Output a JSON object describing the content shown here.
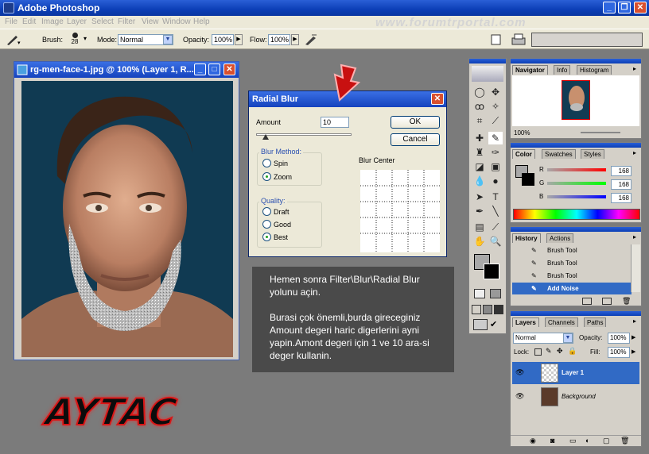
{
  "window": {
    "title": "Adobe Photoshop",
    "minimize": "_",
    "restore": "❐",
    "close": "✕"
  },
  "watermark": "www.forumtrportal.com",
  "menu": [
    "File",
    "Edit",
    "Image",
    "Layer",
    "Select",
    "Filter",
    "View",
    "Window",
    "Help"
  ],
  "options": {
    "brush_label": "Brush:",
    "brush_size": "28",
    "mode_label": "Mode:",
    "mode_value": "Normal",
    "opacity_label": "Opacity:",
    "opacity_value": "100%",
    "flow_label": "Flow:",
    "flow_value": "100%"
  },
  "document": {
    "title": "rg-men-face-1.jpg @ 100% (Layer 1, R...",
    "min": "_",
    "max": "□",
    "close": "✕"
  },
  "dialog": {
    "title": "Radial Blur",
    "close": "✕",
    "amount_label": "Amount",
    "amount_value": "10",
    "amount_fraction": 0.1,
    "ok_label": "OK",
    "cancel_label": "Cancel",
    "blur_method_label": "Blur Method:",
    "spin_label": "Spin",
    "zoom_label": "Zoom",
    "quality_label": "Quality:",
    "draft_label": "Draft",
    "good_label": "Good",
    "best_label": "Best",
    "blur_center_label": "Blur Center"
  },
  "note": {
    "paragraph1": "Hemen sonra Filter\\Blur\\Radial Blur yolunu açin.",
    "paragraph2": "Burasi çok önemli,burda gireceginiz Amount degeri haric digerlerini ayni yapin.Amont degeri için 1 ve 10 ara-si deger kullanin."
  },
  "logo": "AYTAC",
  "navigator": {
    "tabs": [
      "Navigator",
      "Info",
      "Histogram"
    ],
    "zoom": "100%"
  },
  "color": {
    "tabs": [
      "Color",
      "Swatches",
      "Styles"
    ],
    "channels": [
      {
        "name": "R",
        "value": "168",
        "gradient": "#ff0000"
      },
      {
        "name": "G",
        "value": "168",
        "gradient": "#00ff00"
      },
      {
        "name": "B",
        "value": "168",
        "gradient": "#0000ff"
      }
    ]
  },
  "history": {
    "tabs": [
      "History",
      "Actions"
    ],
    "items": [
      "Brush Tool",
      "Brush Tool",
      "Brush Tool",
      "Add Noise"
    ]
  },
  "layers": {
    "tabs": [
      "Layers",
      "Channels",
      "Paths"
    ],
    "mode": "Normal",
    "opacity_label": "Opacity:",
    "opacity_value": "100%",
    "lock_label": "Lock:",
    "fill_label": "Fill:",
    "fill_value": "100%",
    "items": [
      "Layer 1",
      "Background"
    ]
  },
  "colors": {
    "accent": "#316ac5",
    "title_blue": "#0c3fb6",
    "workspace": "#7b7b7b",
    "dialog_bg": "#ece9d8"
  }
}
